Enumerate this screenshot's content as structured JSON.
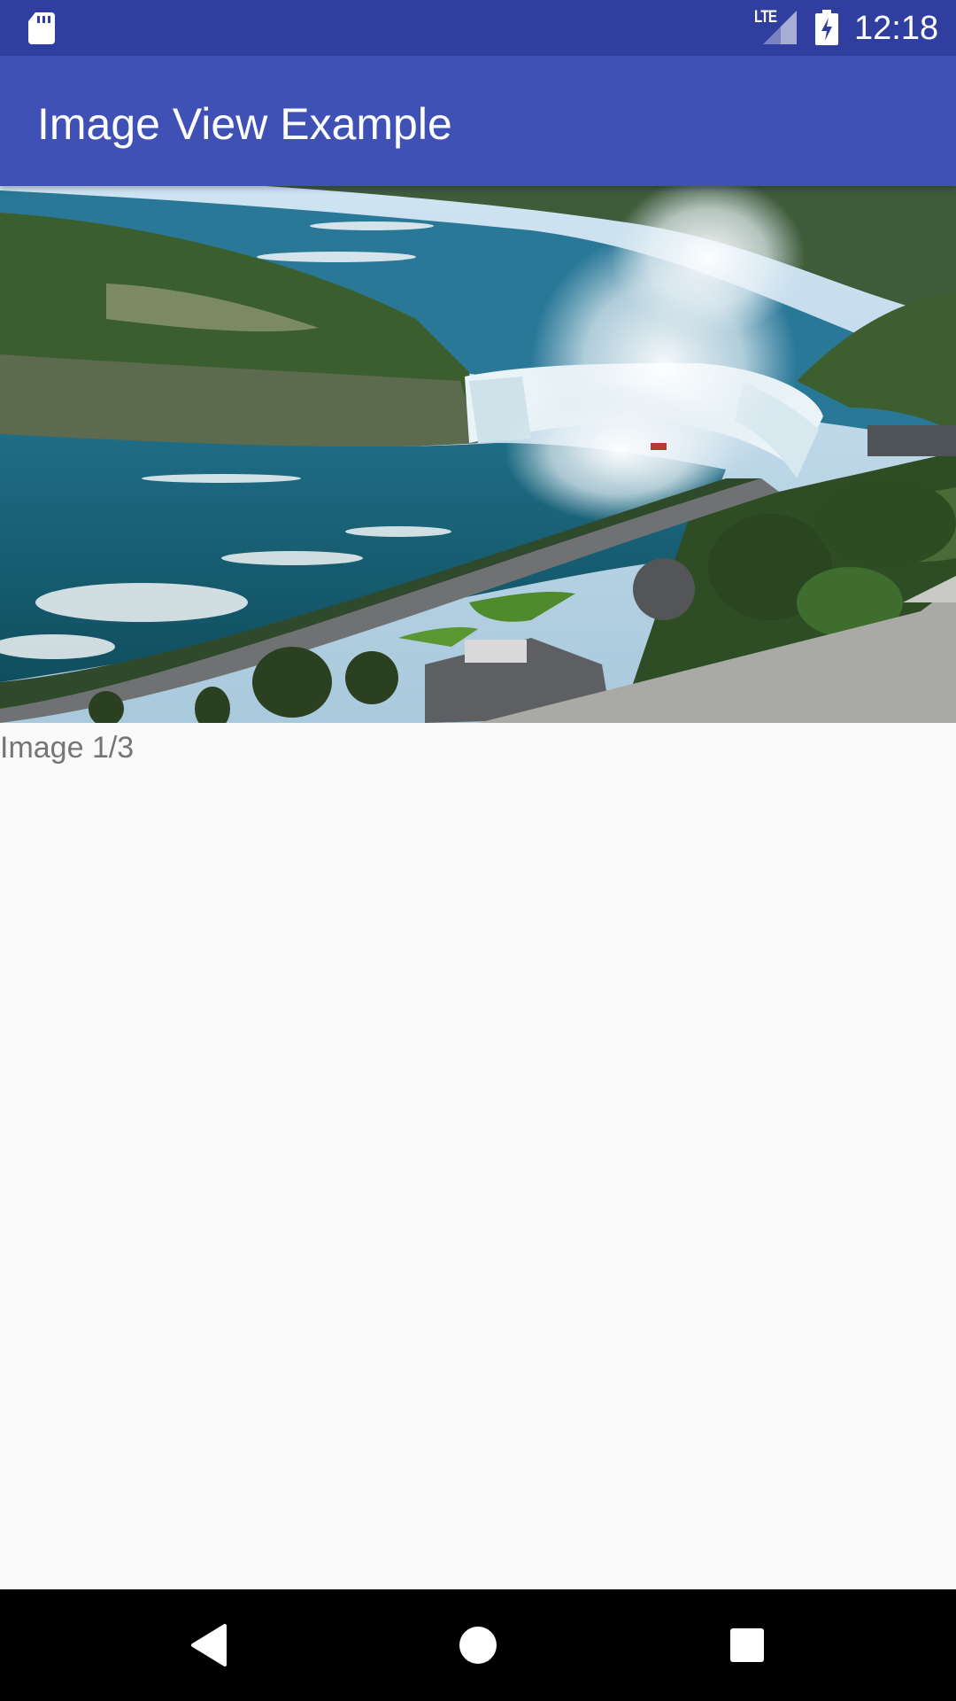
{
  "status_bar": {
    "network": "LTE",
    "time": "12:18",
    "icons": [
      "sd-card-icon",
      "signal-icon",
      "battery-charging-icon"
    ]
  },
  "app_bar": {
    "title": "Image View Example"
  },
  "image_view": {
    "caption": "Image 1/3",
    "subject": "waterfall-aerial-photo"
  },
  "nav_bar": {
    "icons": [
      "back-icon",
      "home-icon",
      "recents-icon"
    ]
  },
  "colors": {
    "status_bar": "#303f9f",
    "app_bar": "#3f51b5",
    "background": "#fafafa",
    "caption_text": "#757575"
  }
}
